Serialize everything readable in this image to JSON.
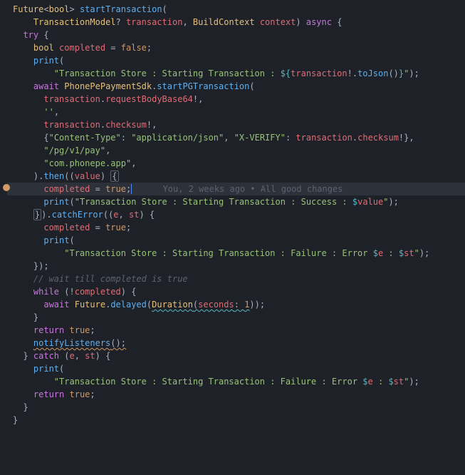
{
  "code": {
    "l1": {
      "t1": "Future",
      "t2": "<",
      "t3": "bool",
      "t4": "> ",
      "t5": "startTransaction",
      "t6": "("
    },
    "l2": {
      "g": "    ",
      "t1": "TransactionModel",
      "t2": "? ",
      "t3": "transaction",
      "t4": ", ",
      "t5": "BuildContext",
      "t6": " ",
      "t7": "context",
      "t8": ") ",
      "t9": "async",
      "t10": " {"
    },
    "l3": {
      "g": "  ",
      "t1": "try",
      "t2": " {"
    },
    "l4": {
      "g": "    ",
      "t1": "bool",
      "t2": " ",
      "t3": "completed",
      "t4": " = ",
      "t5": "false",
      "t6": ";"
    },
    "l5": {
      "g": "    ",
      "t1": "print",
      "t2": "("
    },
    "l6": {
      "g": "        ",
      "t1": "\"Transaction Store : Starting Transaction : ",
      "t2": "${",
      "t3": "transaction",
      "t4": "!.",
      "t5": "toJson",
      "t6": "()",
      "t7": "}",
      "t8": "\"",
      "t9": ");"
    },
    "l7": {
      "g": ""
    },
    "l8": {
      "g": "    ",
      "t1": "await",
      "t2": " ",
      "t3": "PhonePePaymentSdk",
      "t4": ".",
      "t5": "startPGTransaction",
      "t6": "("
    },
    "l9": {
      "g": "      ",
      "t1": "transaction",
      "t2": ".",
      "t3": "requestBodyBase64",
      "t4": "!,"
    },
    "l10": {
      "g": "      ",
      "t1": "''",
      "t2": ","
    },
    "l11": {
      "g": "      ",
      "t1": "transaction",
      "t2": ".",
      "t3": "checksum",
      "t4": "!,"
    },
    "l12": {
      "g": "      ",
      "t1": "{",
      "t2": "\"Content-Type\"",
      "t3": ": ",
      "t4": "\"application/json\"",
      "t5": ", ",
      "t6": "\"X-VERIFY\"",
      "t7": ": ",
      "t8": "transaction",
      "t9": ".",
      "t10": "checksum",
      "t11": "!},"
    },
    "l13": {
      "g": "      ",
      "t1": "\"/pg/v1/pay\"",
      "t2": ","
    },
    "l14": {
      "g": "      ",
      "t1": "\"com.phonepe.app\"",
      "t2": ","
    },
    "l15": {
      "g": "    ",
      "t1": ").",
      "t2": "then",
      "t3": "((",
      "t4": "value",
      "t5": ") ",
      "t6": "{"
    },
    "l16": {
      "g": "      ",
      "t1": "completed",
      "t2": " = ",
      "t3": "true",
      "t4": ";",
      "blame": "      You, 2 weeks ago • All good changes"
    },
    "l17": {
      "g": "      ",
      "t1": "print",
      "t2": "(",
      "t3": "\"Transaction Store : Starting Transaction : Success : ",
      "t4": "$",
      "t5": "value",
      "t6": "\"",
      "t7": ");"
    },
    "l18": {
      "g": "    ",
      "t1": "}",
      "t2": ").",
      "t3": "catchError",
      "t4": "((",
      "t5": "e",
      "t6": ", ",
      "t7": "st",
      "t8": ") {"
    },
    "l19": {
      "g": "      ",
      "t1": "completed",
      "t2": " = ",
      "t3": "true",
      "t4": ";"
    },
    "l20": {
      "g": "      ",
      "t1": "print",
      "t2": "("
    },
    "l21": {
      "g": "          ",
      "t1": "\"Transaction Store : Starting Transaction : Failure : Error ",
      "t2": "$",
      "t3": "e",
      "t4": " : ",
      "t5": "$",
      "t6": "st",
      "t7": "\"",
      "t8": ");"
    },
    "l22": {
      "g": "    ",
      "t1": "});"
    },
    "l23": {
      "g": ""
    },
    "l24": {
      "g": "    ",
      "t1": "// wait till completed is true"
    },
    "l25": {
      "g": "    ",
      "t1": "while",
      "t2": " (!",
      "t3": "completed",
      "t4": ") {"
    },
    "l26": {
      "g": "      ",
      "t1": "await",
      "t2": " ",
      "t3": "Future",
      "t4": ".",
      "t5": "delayed",
      "t6": "(",
      "t7": "Duration",
      "t8": "(",
      "t9": "seconds",
      "t10": ": ",
      "t11": "1",
      "t12": "));"
    },
    "l27": {
      "g": "    ",
      "t1": "}"
    },
    "l28": {
      "g": ""
    },
    "l29": {
      "g": "    ",
      "t1": "return",
      "t2": " ",
      "t3": "true",
      "t4": ";"
    },
    "l30": {
      "g": "    ",
      "t1": "notifyListeners",
      "t2": "();"
    },
    "l31": {
      "g": "  ",
      "t1": "} ",
      "t2": "catch",
      "t3": " (",
      "t4": "e",
      "t5": ", ",
      "t6": "st",
      "t7": ") {"
    },
    "l32": {
      "g": "    ",
      "t1": "print",
      "t2": "("
    },
    "l33": {
      "g": "        ",
      "t1": "\"Transaction Store : Starting Transaction : Failure : Error ",
      "t2": "$",
      "t3": "e",
      "t4": " : ",
      "t5": "$",
      "t6": "st",
      "t7": "\"",
      "t8": ");"
    },
    "l34": {
      "g": "    ",
      "t1": "return",
      "t2": " ",
      "t3": "true",
      "t4": ";"
    },
    "l35": {
      "g": "  ",
      "t1": "}"
    },
    "l36": {
      "g": "",
      "t1": "}"
    }
  }
}
